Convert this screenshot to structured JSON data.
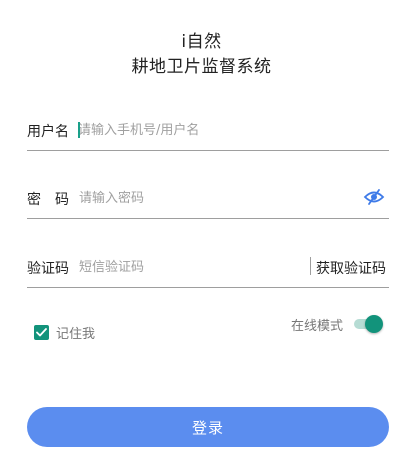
{
  "header": {
    "app_name": "i自然",
    "subtitle": "耕地卫片监督系统"
  },
  "form": {
    "username": {
      "label": "用户名",
      "value": "",
      "placeholder": "请输入手机号/用户名"
    },
    "password": {
      "label": "密　码",
      "value": "",
      "placeholder": "请输入密码",
      "toggle_icon": "eye-slash-icon"
    },
    "code": {
      "label": "验证码",
      "value": "",
      "placeholder": "短信验证码",
      "get_code_label": "获取验证码"
    }
  },
  "options": {
    "remember_label": "记住我",
    "remember_checked": true,
    "online_mode_label": "在线模式",
    "online_mode_on": true
  },
  "actions": {
    "login_label": "登录"
  },
  "colors": {
    "accent": "#12937b",
    "primary_button": "#5b8def",
    "eye_icon": "#3f7be8"
  }
}
